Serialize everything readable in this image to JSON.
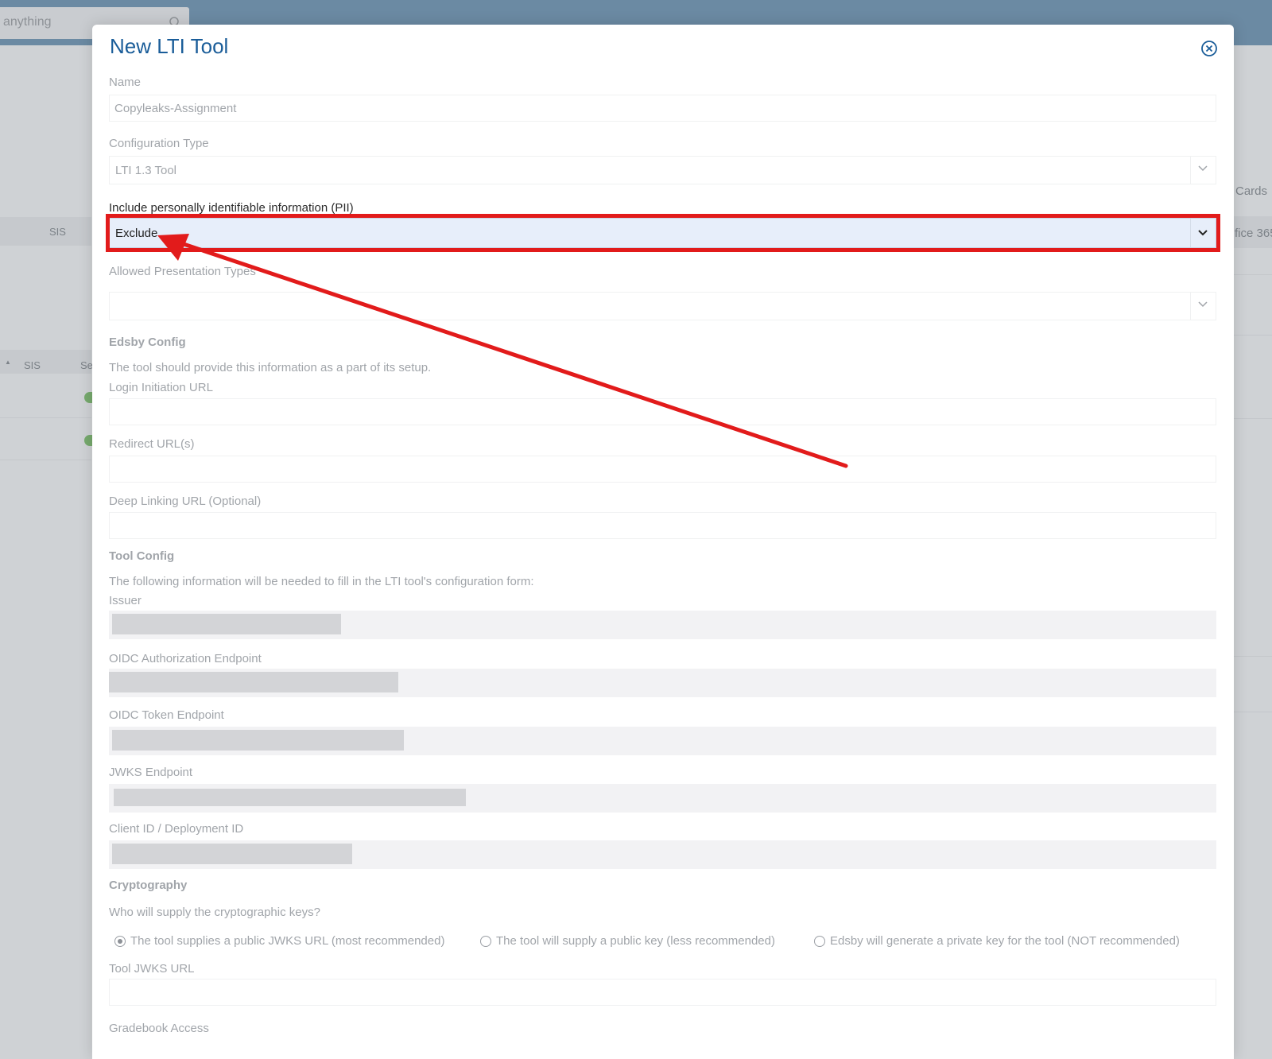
{
  "background": {
    "search_placeholder": "anything",
    "right_cards_label": "Cards",
    "right_office_label": "fice 365",
    "left_sis_label": "SIS",
    "left_sis_sort_label": "SIS",
    "left_se_label": "Se"
  },
  "modal": {
    "title": "New LTI Tool",
    "name": {
      "label": "Name",
      "value": "Copyleaks-Assignment"
    },
    "configuration_type": {
      "label": "Configuration Type",
      "value": "LTI 1.3 Tool"
    },
    "pii": {
      "label": "Include personally identifiable information (PII)",
      "value": "Exclude"
    },
    "presentation_types": {
      "label": "Allowed Presentation Types",
      "value": ""
    },
    "edsby_config": {
      "title": "Edsby Config",
      "help": "The tool should provide this information as a part of its setup.",
      "login_url_label": "Login Initiation URL",
      "login_url_value": "",
      "redirect_label": "Redirect URL(s)",
      "redirect_value": "",
      "deep_linking_label": "Deep Linking URL (Optional)",
      "deep_linking_value": ""
    },
    "tool_config": {
      "title": "Tool Config",
      "help": "The following information will be needed to fill in the LTI tool's configuration form:",
      "issuer_label": "Issuer",
      "oidc_auth_label": "OIDC Authorization Endpoint",
      "oidc_token_label": "OIDC Token Endpoint",
      "jwks_label": "JWKS Endpoint",
      "client_id_label": "Client ID / Deployment ID"
    },
    "cryptography": {
      "title": "Cryptography",
      "question": "Who will supply the cryptographic keys?",
      "options": [
        "The tool supplies a public JWKS URL (most recommended)",
        "The tool will supply a public key (less recommended)",
        "Edsby will generate a private key for the tool (NOT recommended)"
      ],
      "selected_index": 0,
      "tool_jwks_label": "Tool JWKS URL",
      "tool_jwks_value": ""
    },
    "gradebook": {
      "label": "Gradebook Access"
    }
  },
  "colors": {
    "title_blue": "#1a5d99",
    "highlight_red": "#e21b1b",
    "topbar": "#6b8aa3"
  }
}
